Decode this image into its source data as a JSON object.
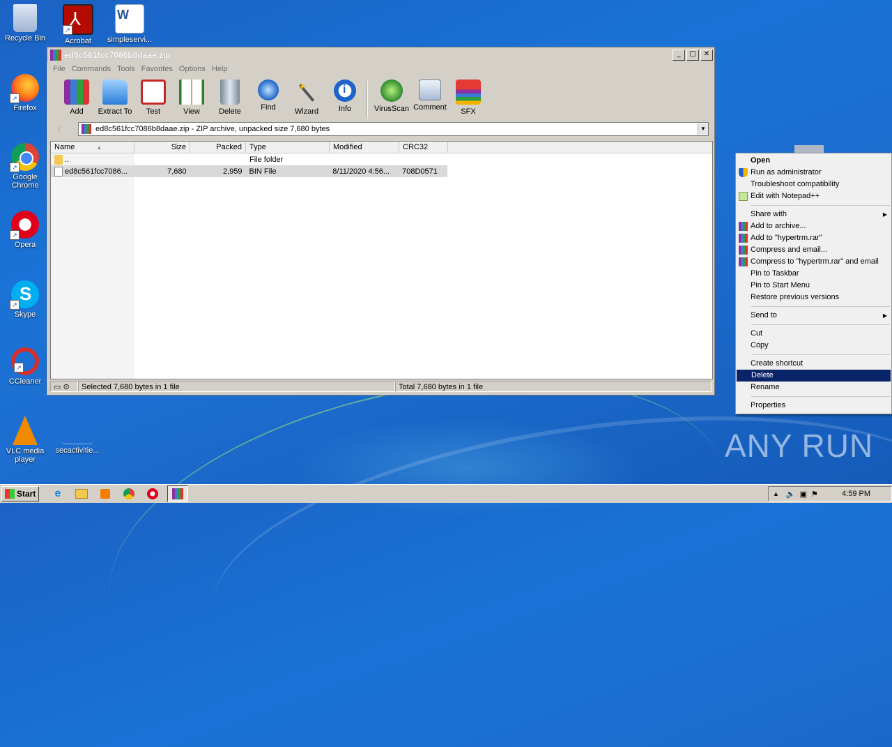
{
  "desktop": {
    "icons": [
      {
        "label": "Recycle Bin"
      },
      {
        "label": "Acrobat"
      },
      {
        "label": "simpleservi..."
      },
      {
        "label": "Firefox"
      },
      {
        "label": "Google Chrome"
      },
      {
        "label": "Opera"
      },
      {
        "label": "Skype"
      },
      {
        "label": "CCleaner"
      },
      {
        "label": "VLC media player"
      },
      {
        "label": "secactivitie..."
      }
    ],
    "watermark": "ANY RUN"
  },
  "window": {
    "title": "ed8c561fcc7086b8daae.zip",
    "menu": [
      "File",
      "Commands",
      "Tools",
      "Favorites",
      "Options",
      "Help"
    ],
    "toolbar": [
      "Add",
      "Extract To",
      "Test",
      "View",
      "Delete",
      "Find",
      "Wizard",
      "Info",
      "VirusScan",
      "Comment",
      "SFX"
    ],
    "address": "ed8c561fcc7086b8daae.zip - ZIP archive, unpacked size 7,680 bytes",
    "columns": [
      "Name",
      "Size",
      "Packed",
      "Type",
      "Modified",
      "CRC32"
    ],
    "rows": [
      {
        "name": "..",
        "size": "",
        "packed": "",
        "type": "File folder",
        "modified": "",
        "crc": ""
      },
      {
        "name": "ed8c561fcc7086...",
        "size": "7,680",
        "packed": "2,959",
        "type": "BIN File",
        "modified": "8/11/2020 4:56...",
        "crc": "708D0571"
      }
    ],
    "status_left": "Selected 7,680 bytes in 1 file",
    "status_right": "Total 7,680 bytes in 1 file"
  },
  "context_menu": {
    "items": [
      {
        "label": "Open"
      },
      {
        "label": "Run as administrator"
      },
      {
        "label": "Troubleshoot compatibility"
      },
      {
        "label": "Edit with Notepad++"
      },
      {
        "label": "Share with"
      },
      {
        "label": "Add to archive..."
      },
      {
        "label": "Add to \"hypertrm.rar\""
      },
      {
        "label": "Compress and email..."
      },
      {
        "label": "Compress to \"hypertrm.rar\" and email"
      },
      {
        "label": "Pin to Taskbar"
      },
      {
        "label": "Pin to Start Menu"
      },
      {
        "label": "Restore previous versions"
      },
      {
        "label": "Send to"
      },
      {
        "label": "Cut"
      },
      {
        "label": "Copy"
      },
      {
        "label": "Create shortcut"
      },
      {
        "label": "Delete"
      },
      {
        "label": "Rename"
      },
      {
        "label": "Properties"
      }
    ]
  },
  "taskbar": {
    "start_label": "Start",
    "clock": "4:59 PM"
  },
  "colors": {
    "highlight": "#0a246a",
    "desktop": "#1a73d6",
    "window_chrome": "#d4d0c8"
  }
}
